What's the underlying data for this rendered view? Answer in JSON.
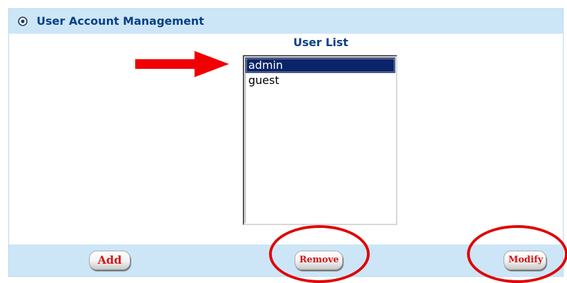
{
  "header": {
    "title": "User Account Management",
    "icon": "circle-bullet-icon"
  },
  "user_list": {
    "title": "User List",
    "items": [
      {
        "label": "admin",
        "selected": true
      },
      {
        "label": "guest",
        "selected": false
      }
    ]
  },
  "buttons": {
    "add_label": "Add",
    "remove_label": "Remove",
    "modify_label": "Modify"
  },
  "annotations": {
    "arrow_color": "#e00000",
    "circle_color": "#e00000"
  },
  "colors": {
    "bar_background": "#cde6f7",
    "title_color": "#0a3f86",
    "selected_row": "#0b2468",
    "button_text": "#d11616"
  }
}
